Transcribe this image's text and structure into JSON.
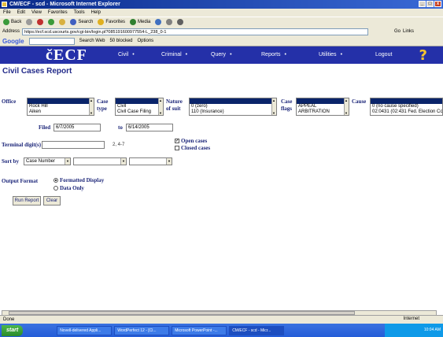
{
  "window": {
    "title": "CM/ECF - scd - Microsoft Internet Explorer"
  },
  "menu": [
    "File",
    "Edit",
    "View",
    "Favorites",
    "Tools",
    "Help"
  ],
  "toolbar": {
    "back": "Back",
    "search": "Search",
    "favorites": "Favorites",
    "media": "Media"
  },
  "address": {
    "label": "Address",
    "url": "https://ecf.scd.uscourts.gov/cgi-bin/login.pl?085191600977554-L_238_0-1",
    "go": "Go",
    "links": "Links"
  },
  "google": {
    "logo": "Google",
    "search_web": "Search Web",
    "blocked": "50 blocked",
    "options": "Options"
  },
  "ecf": {
    "logo": "ECF",
    "nav": [
      "Civil",
      "Criminal",
      "Query",
      "Reports",
      "Utilities",
      "Logout"
    ],
    "help": "?"
  },
  "report": {
    "title": "Civil Cases Report",
    "office_label": "Office",
    "office_options": [
      "Rock Hill",
      "Aiken"
    ],
    "case_type_label_1": "Case",
    "case_type_label_2": "type",
    "case_type_options": [
      "Civil",
      "Civil Case Filing"
    ],
    "nature_label_1": "Nature",
    "nature_label_2": "of suit",
    "nature_options": [
      "0 (zero)",
      "110 (Insurance)"
    ],
    "flags_label_1": "Case",
    "flags_label_2": "flags",
    "flags_options": [
      "APPEAL",
      "ARBITRATION"
    ],
    "cause_label": "Cause",
    "cause_options": [
      "0 (no cause specified)",
      "02:0431 (02:431 Fed. Election Commission)"
    ],
    "filed_label": "Filed",
    "filed_from": "6/7/2005",
    "filed_to_label": "to",
    "filed_to": "6/14/2005",
    "terminal_label": "Terminal digit(s)",
    "terminal_hint": "2, 4-7",
    "open_cases": "Open cases",
    "closed_cases": "Closed cases",
    "sort_label": "Sort by",
    "sort_value": "Case Number",
    "output_label": "Output Format",
    "formatted_display": "Formatted Display",
    "data_only": "Data Only",
    "run_report": "Run Report",
    "clear": "Clear"
  },
  "status": {
    "text": "Done",
    "zone": "Internet"
  },
  "taskbar": {
    "start": "start",
    "tasks": [
      "Novell-delivered Appli...",
      "WordPerfect 12 - [Cl...",
      "Microsoft PowerPoint -...",
      "CM/ECF - scd - Micr..."
    ],
    "clock": "10:04 AM"
  }
}
